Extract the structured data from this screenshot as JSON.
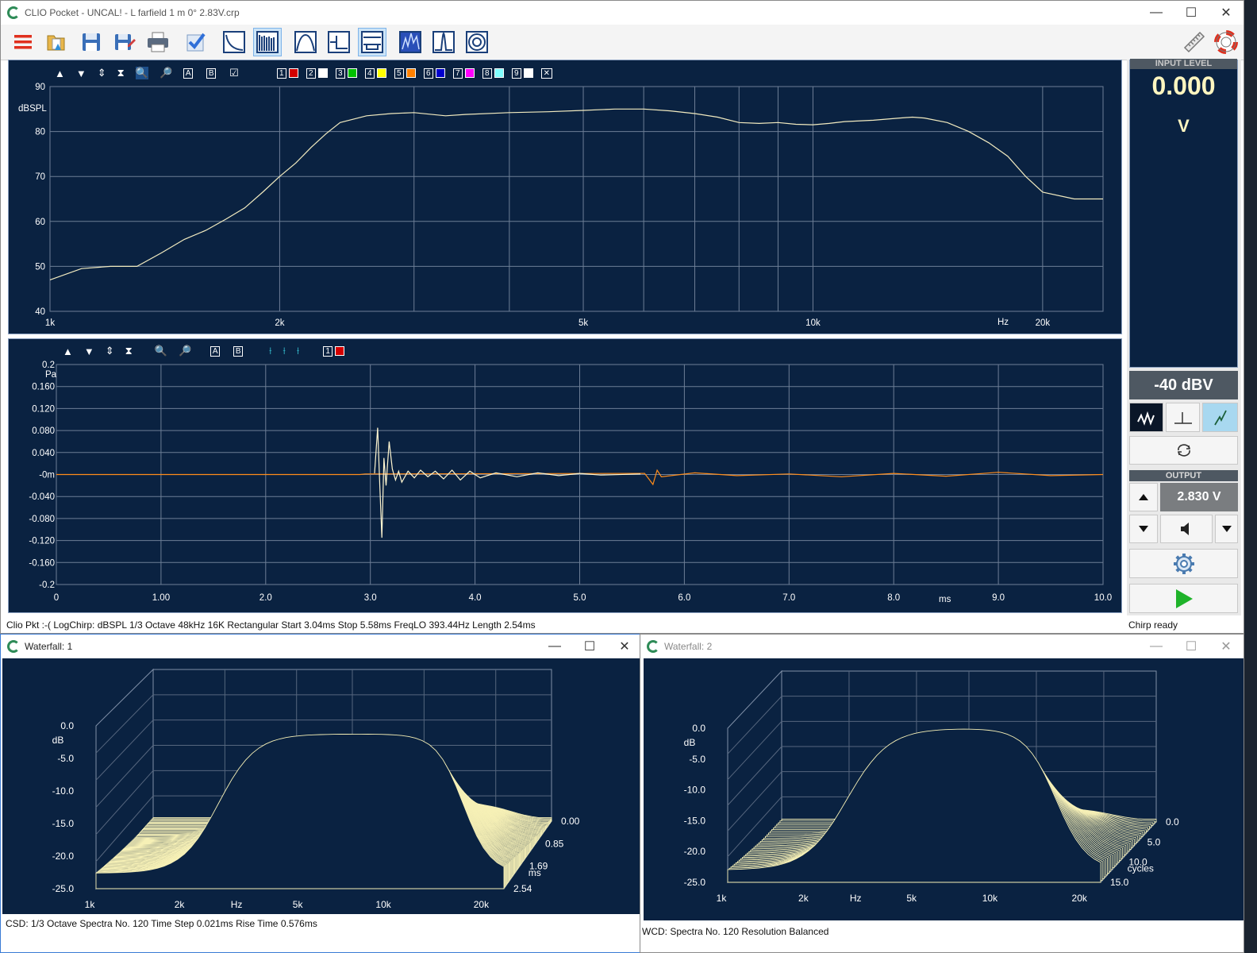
{
  "app": {
    "title": "CLIO Pocket - UNCAL! - L farfield 1 m 0° 2.83V.crp",
    "window_buttons": [
      "—",
      "☐",
      "✕"
    ]
  },
  "toolbar": {
    "icons": [
      "menu-icon",
      "open-folder-icon",
      "save-icon",
      "save-as-icon",
      "print-icon",
      "check-icon",
      "freq-response-icon",
      "spectrum-icon",
      "filter-icon",
      "impulse-icon",
      "window-icon",
      "waterfall-icon",
      "peak-icon",
      "polar-icon",
      "ruler-icon",
      "help-lifebuoy-icon"
    ]
  },
  "fr_panel": {
    "toolbar_letters": [
      "A",
      "B"
    ],
    "trace_numbers": [
      "1",
      "2",
      "3",
      "4",
      "5",
      "6",
      "7",
      "8",
      "9"
    ],
    "trace_colors": [
      "#d40000",
      "#ffffff",
      "#00c000",
      "#ffff00",
      "#ff8000",
      "#0000cc",
      "#ff00ff",
      "#80ffff",
      "#ffffff"
    ],
    "close_glyph": "✕",
    "y_unit": "dBSPL",
    "x_unit": "Hz"
  },
  "imp_panel": {
    "toolbar_letters": [
      "A",
      "B"
    ],
    "trace_number": "1",
    "y_unit": "Pa",
    "x_unit": "ms"
  },
  "chart_data": [
    {
      "type": "line",
      "title": "",
      "ylabel": "dBSPL",
      "xlabel": "Hz",
      "xscale": "log",
      "xlim": [
        1000,
        24000
      ],
      "ylim": [
        40,
        90
      ],
      "yticks": [
        "90",
        "80",
        "70",
        "60",
        "50",
        "40"
      ],
      "xticks": [
        {
          "v": 1000,
          "label": "1k"
        },
        {
          "v": 2000,
          "label": "2k"
        },
        {
          "v": 5000,
          "label": "5k"
        },
        {
          "v": 10000,
          "label": "10k"
        },
        {
          "v": 20000,
          "label": "20k"
        }
      ],
      "grid": true,
      "series": [
        {
          "color": "#f2ebc0",
          "x": [
            1000,
            1100,
            1200,
            1300,
            1400,
            1500,
            1600,
            1700,
            1800,
            1900,
            2000,
            2100,
            2200,
            2300,
            2400,
            2600,
            2800,
            3000,
            3300,
            3500,
            4000,
            4500,
            5000,
            5500,
            6000,
            6500,
            7000,
            7500,
            8000,
            8500,
            9000,
            9500,
            10000,
            10500,
            11000,
            12000,
            13000,
            13500,
            14000,
            15000,
            16000,
            17000,
            18000,
            19000,
            20000,
            22000,
            24000
          ],
          "y": [
            47,
            49.5,
            50,
            50,
            53,
            56,
            58,
            60.5,
            63,
            66.5,
            70,
            73,
            76.5,
            79.5,
            82,
            83.5,
            84,
            84.2,
            83.5,
            83.8,
            84.2,
            84.4,
            84.7,
            85,
            85,
            84.6,
            84,
            83.2,
            82,
            81.8,
            82,
            81.6,
            81.5,
            81.8,
            82.2,
            82.5,
            83,
            83.2,
            83,
            82,
            80,
            77.5,
            74.5,
            70,
            66.5,
            65,
            65
          ]
        }
      ]
    },
    {
      "type": "line",
      "title": "",
      "ylabel": "Pa",
      "xlabel": "ms",
      "xlim": [
        0,
        10
      ],
      "ylim": [
        -0.2,
        0.2
      ],
      "yticks": [
        "0.2",
        "0.160",
        "0.120",
        "0.080",
        "0.040",
        "-0m",
        "-0.040",
        "-0.080",
        "-0.120",
        "-0.160",
        "-0.2"
      ],
      "xticks": [
        "0",
        "1.00",
        "2.0",
        "3.0",
        "4.0",
        "5.0",
        "6.0",
        "7.0",
        "8.0",
        "9.0",
        "10.0"
      ],
      "grid": true,
      "window_start_ms": 3.04,
      "window_stop_ms": 5.58,
      "series": [
        {
          "color": "#ff8c1a",
          "x": [
            0,
            2.9,
            2.95,
            5.62,
            5.66,
            5.7,
            5.74,
            5.78,
            6.1,
            6.5,
            7.0,
            7.5,
            8.0,
            8.5,
            9.0,
            9.5,
            10.0
          ],
          "y": [
            0,
            0,
            0.001,
            0.002,
            -0.008,
            -0.018,
            0.008,
            -0.004,
            0.003,
            -0.002,
            0.001,
            -0.004,
            0.002,
            -0.003,
            0.004,
            -0.002,
            0
          ]
        },
        {
          "color": "#fff6d0",
          "x": [
            3.04,
            3.07,
            3.09,
            3.11,
            3.13,
            3.15,
            3.18,
            3.21,
            3.24,
            3.27,
            3.3,
            3.36,
            3.42,
            3.48,
            3.55,
            3.62,
            3.7,
            3.78,
            3.86,
            3.95,
            4.05,
            4.2,
            4.4,
            4.6,
            4.8,
            5.0,
            5.2,
            5.58
          ],
          "y": [
            0.002,
            0.085,
            -0.02,
            -0.115,
            0.03,
            -0.02,
            0.06,
            0.01,
            -0.01,
            0.006,
            -0.014,
            0.006,
            -0.006,
            0.008,
            -0.004,
            0.006,
            -0.008,
            0.008,
            -0.01,
            0.006,
            -0.006,
            0.003,
            -0.004,
            0.003,
            -0.002,
            0.002,
            -0.001,
            0.001
          ]
        }
      ]
    },
    {
      "type": "area",
      "title": "",
      "ylabel": "dB",
      "xlabel": "Hz",
      "zlabel": "ms",
      "yticks": [
        "0.0",
        "-5.0",
        "-10.0",
        "-15.0",
        "-20.0",
        "-25.0"
      ],
      "xticks": [
        "1k",
        "2k",
        "Hz",
        "5k",
        "10k",
        "20k"
      ],
      "zticks": [
        "0.00",
        "0.85",
        "1.69",
        "2.54"
      ],
      "color": "#f6f0b6"
    },
    {
      "type": "area",
      "title": "",
      "ylabel": "dB",
      "xlabel": "Hz",
      "zlabel": "cycles",
      "yticks": [
        "0.0",
        "-5.0",
        "-10.0",
        "-15.0",
        "-20.0",
        "-25.0"
      ],
      "xticks": [
        "1k",
        "2k",
        "Hz",
        "5k",
        "10k",
        "20k"
      ],
      "zticks": [
        "0.0",
        "5.0",
        "10.0",
        "15.0"
      ],
      "color": "#f6f0b6"
    }
  ],
  "status_main": "Clio Pkt :-( LogChirp:  dBSPL   1/3 Octave   48kHz   16K   Rectangular   Start 3.04ms   Stop 5.58ms   FreqLO 393.44Hz   Length 2.54ms",
  "status_right": "Chirp ready",
  "input_level": {
    "label": "INPUT LEVEL",
    "value": "0.000",
    "unit": "V",
    "range": "-40 dBV"
  },
  "output": {
    "label": "OUTPUT",
    "value": "2.830 V"
  },
  "waterfall1": {
    "title": "Waterfall: 1",
    "status": "CSD:   1/3 Octave   Spectra No. 120   Time Step 0.021ms   Rise Time 0.576ms"
  },
  "waterfall2": {
    "title": "Waterfall: 2",
    "status": "WCD:   Spectra No. 120   Resolution Balanced"
  }
}
